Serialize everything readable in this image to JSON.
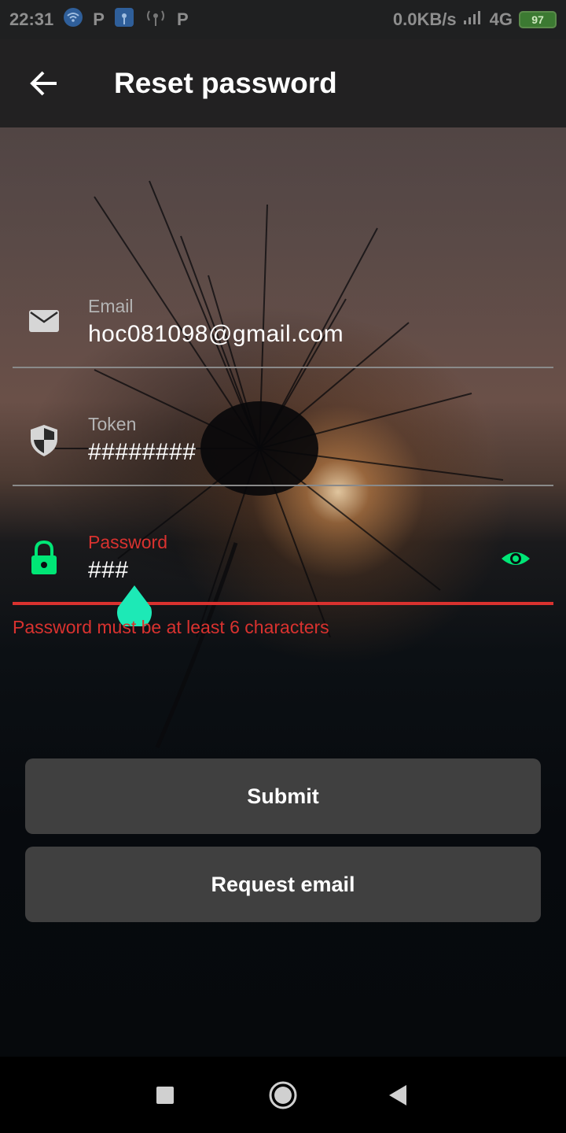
{
  "status_bar": {
    "time": "22:31",
    "net_speed": "0.0KB/s",
    "network": "4G",
    "battery": "97",
    "icons": [
      "wifi-hotspot-icon",
      "parking-icon",
      "cast-icon",
      "antenna-icon",
      "parking-icon",
      "signal-icon"
    ]
  },
  "app_bar": {
    "title": "Reset password"
  },
  "form": {
    "email": {
      "label": "Email",
      "value": "hoc081098@gmail.com"
    },
    "token": {
      "label": "Token",
      "value": "########"
    },
    "password": {
      "label": "Password",
      "value": "###",
      "error": "Password must be at least 6 characters"
    }
  },
  "buttons": {
    "submit": "Submit",
    "request_email": "Request email"
  },
  "colors": {
    "accent": "#1de9b6",
    "icon_green": "#00e676",
    "error": "#d9322f",
    "button_bg": "#404040"
  }
}
